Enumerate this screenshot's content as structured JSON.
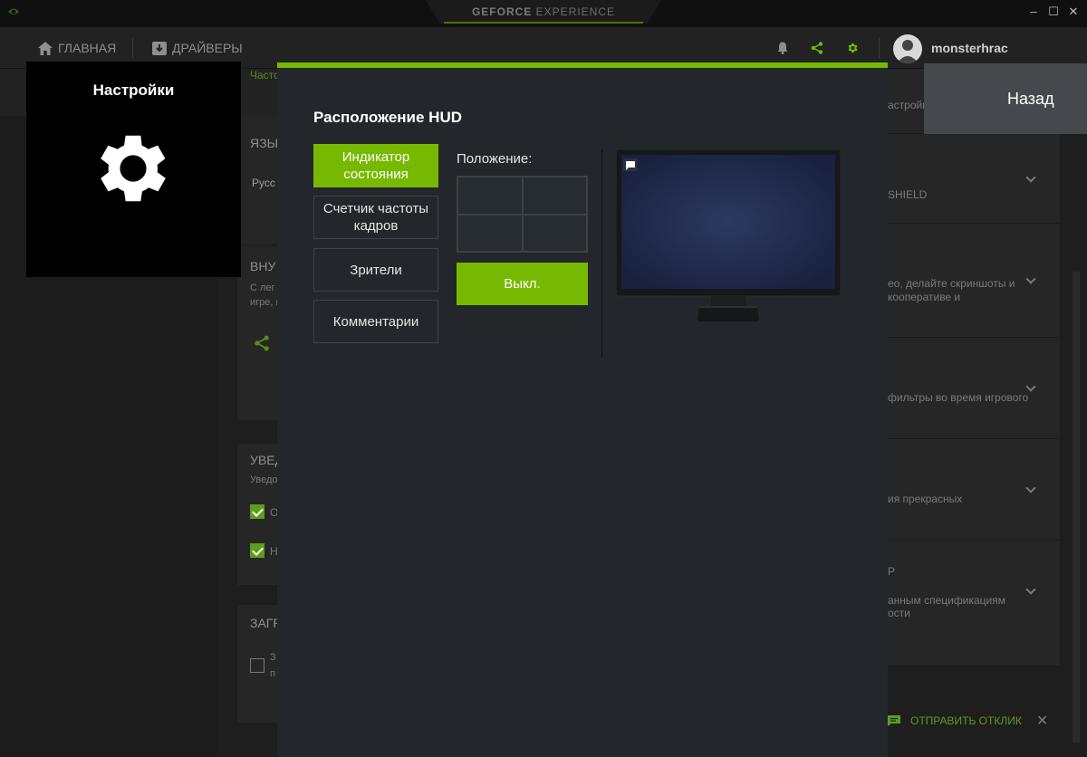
{
  "titlebar": {
    "brand_bold": "GEFORCE",
    "brand_rest": " EXPERIENCE",
    "minimize": "–",
    "maximize": "☐",
    "close": "✕"
  },
  "nav": {
    "home": "ГЛАВНАЯ",
    "drivers": "ДРАЙВЕРЫ",
    "username": "monsterhrac",
    "accent": "#76b900"
  },
  "background": {
    "top_link": "Часто",
    "lang_head": "ЯЗЫ",
    "lang_value": "Русс",
    "overlay_head": "ВНУ",
    "overlay_line1": "С лег",
    "overlay_line2": "игре, и",
    "notif_head": "УВЕД",
    "notif_line": "Уведо",
    "chk1": "О",
    "chk2": "Н",
    "download_head": "ЗАГР",
    "download_line1": "З",
    "download_line2": "п",
    "right_top": "астройки",
    "right_rows": [
      [
        "SHIELD"
      ],
      [
        "ео, делайте скриншоты и",
        "кооперативе и"
      ],
      [
        "фильтры во время игрового"
      ],
      [
        "ия прекрасных"
      ],
      [
        "P",
        "анным спецификациям",
        "ости"
      ]
    ],
    "feedback": "ОТПРАВИТЬ ОТКЛИК",
    "feedback_close": "✕"
  },
  "settings_panel": {
    "title": "Настройки"
  },
  "back_button": "Назад",
  "modal": {
    "title": "Расположение HUD",
    "options": [
      {
        "label": "Индикатор состояния",
        "active": true
      },
      {
        "label": "Счетчик частоты кадров",
        "active": false
      },
      {
        "label": "Зрители",
        "active": false
      },
      {
        "label": "Комментарии",
        "active": false
      }
    ],
    "position_label": "Положение:",
    "off_button": "Выкл."
  }
}
